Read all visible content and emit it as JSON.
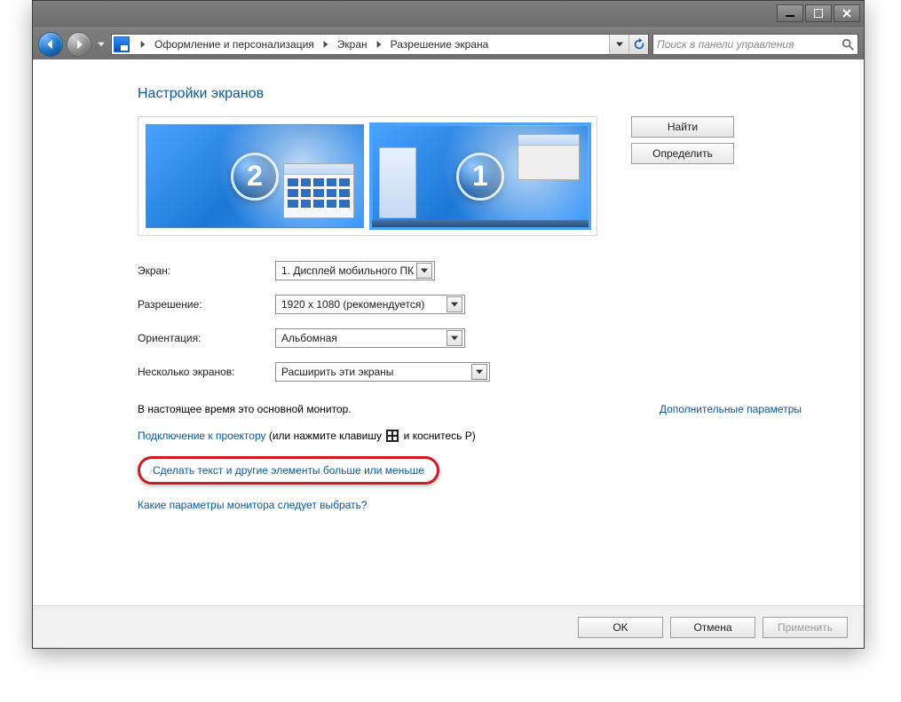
{
  "breadcrumb": {
    "root_tip": "",
    "seg1": "Оформление и персонализация",
    "seg2": "Экран",
    "seg3": "Разрешение экрана"
  },
  "search": {
    "placeholder": "Поиск в панели управления"
  },
  "heading": "Настройки экранов",
  "monitors": {
    "m1_num": "1",
    "m2_num": "2"
  },
  "actions": {
    "find": "Найти",
    "identify": "Определить"
  },
  "form": {
    "screen_label": "Экран:",
    "screen_value": "1. Дисплей мобильного ПК",
    "res_label": "Разрешение:",
    "res_value": "1920 х 1080 (рекомендуется)",
    "orient_label": "Ориентация:",
    "orient_value": "Альбомная",
    "multi_label": "Несколько экранов:",
    "multi_value": "Расширить эти экраны"
  },
  "notes": {
    "main_monitor": "В настоящее время это основной монитор.",
    "adv_link": "Дополнительные параметры",
    "projector_prefix": "Подключение к проектору",
    "projector_suffix_a": " (или нажмите клавишу ",
    "projector_suffix_b": " и коснитесь P)",
    "text_size_link": "Сделать текст и другие элементы больше или меньше",
    "which_params": "Какие параметры монитора следует выбрать?"
  },
  "buttons": {
    "ok": "OK",
    "cancel": "Отмена",
    "apply": "Применить"
  }
}
